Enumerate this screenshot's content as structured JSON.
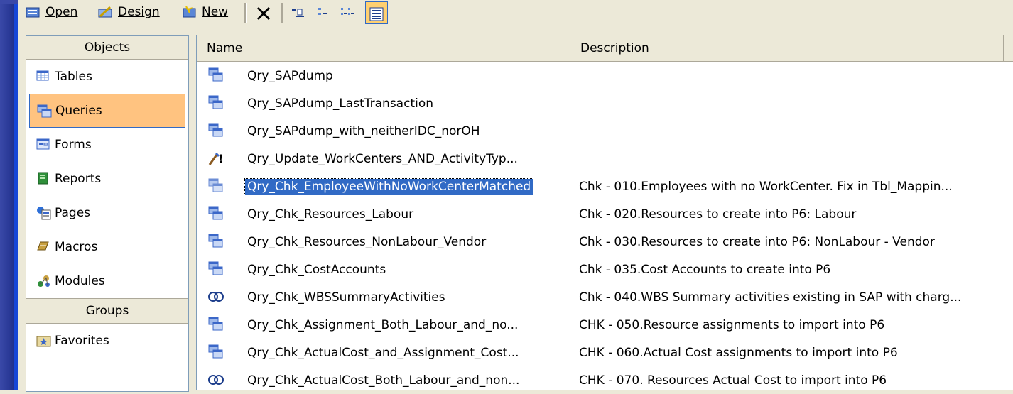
{
  "toolbar": {
    "open_label": "Open",
    "design_label": "Design",
    "new_label": "New"
  },
  "objects": {
    "header": "Objects",
    "items": [
      {
        "label": "Tables",
        "icon": "table-icon"
      },
      {
        "label": "Queries",
        "icon": "query-icon",
        "selected": true
      },
      {
        "label": "Forms",
        "icon": "form-icon"
      },
      {
        "label": "Reports",
        "icon": "report-icon"
      },
      {
        "label": "Pages",
        "icon": "page-icon"
      },
      {
        "label": "Macros",
        "icon": "macro-icon"
      },
      {
        "label": "Modules",
        "icon": "module-icon"
      }
    ],
    "groups_header": "Groups",
    "groups": [
      {
        "label": "Favorites",
        "icon": "favorites-icon"
      }
    ]
  },
  "list": {
    "col_name": "Name",
    "col_desc": "Description",
    "rows": [
      {
        "name": "Qry_SAPdump",
        "desc": "",
        "icon": "select-query-icon"
      },
      {
        "name": "Qry_SAPdump_LastTransaction",
        "desc": "",
        "icon": "select-query-icon"
      },
      {
        "name": "Qry_SAPdump_with_neitherIDC_norOH",
        "desc": "",
        "icon": "select-query-icon"
      },
      {
        "name": "Qry_Update_WorkCenters_AND_ActivityTyp...",
        "desc": "",
        "icon": "update-query-icon"
      },
      {
        "name": "Qry_Chk_EmployeeWithNoWorkCenterMatched",
        "desc": "Chk - 010.Employees with no WorkCenter. Fix in Tbl_Mappin...",
        "icon": "select-query-icon",
        "selected": true
      },
      {
        "name": "Qry_Chk_Resources_Labour",
        "desc": "Chk - 020.Resources to create into P6: Labour",
        "icon": "select-query-icon"
      },
      {
        "name": "Qry_Chk_Resources_NonLabour_Vendor",
        "desc": "Chk - 030.Resources to create into P6: NonLabour - Vendor",
        "icon": "select-query-icon"
      },
      {
        "name": "Qry_Chk_CostAccounts",
        "desc": "Chk - 035.Cost Accounts to create into P6",
        "icon": "select-query-icon"
      },
      {
        "name": "Qry_Chk_WBSSummaryActivities",
        "desc": "Chk - 040.WBS Summary activities existing in SAP with charg...",
        "icon": "union-query-icon"
      },
      {
        "name": "Qry_Chk_Assignment_Both_Labour_and_no...",
        "desc": "CHK - 050.Resource assignments to import into P6",
        "icon": "select-query-icon"
      },
      {
        "name": "Qry_Chk_ActualCost_and_Assignment_Cost...",
        "desc": "CHK - 060.Actual Cost assignments to import into P6",
        "icon": "select-query-icon"
      },
      {
        "name": "Qry_Chk_ActualCost_Both_Labour_and_non...",
        "desc": "CHK - 070. Resources Actual Cost to import into P6",
        "icon": "union-query-icon"
      }
    ]
  }
}
